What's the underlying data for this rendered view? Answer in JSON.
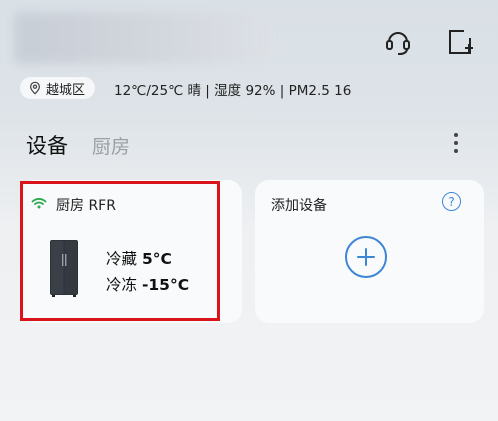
{
  "header": {
    "location": "越城区",
    "weather_text": "12℃/25℃  晴 | 湿度 92% | PM2.5 16"
  },
  "tabs": [
    "设备",
    "厨房"
  ],
  "device_card": {
    "name": "厨房  RFR",
    "fridge_label": "冷藏",
    "fridge_value": "5°C",
    "freezer_label": "冷冻",
    "freezer_value": "-15°C"
  },
  "add_card": {
    "title": "添加设备",
    "help_symbol": "?"
  },
  "colors": {
    "accent": "#3d86d6",
    "wifi_green": "#2ea84f",
    "highlight_red": "#d9151b"
  },
  "icons": [
    "headset-icon",
    "add-screen-icon",
    "location-pin-icon",
    "more-icon",
    "wifi-icon",
    "fridge-icon",
    "help-icon",
    "plus-icon"
  ]
}
